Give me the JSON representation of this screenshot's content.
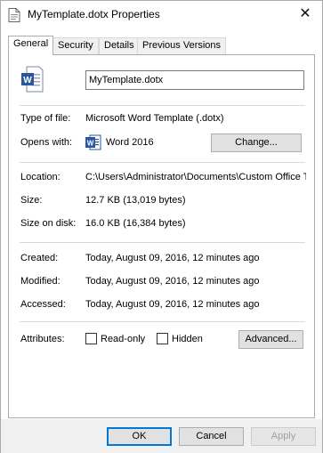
{
  "window": {
    "title": "MyTemplate.dotx Properties",
    "close_glyph": "✕"
  },
  "tabs": [
    {
      "label": "General",
      "active": true
    },
    {
      "label": "Security",
      "active": false
    },
    {
      "label": "Details",
      "active": false
    },
    {
      "label": "Previous Versions",
      "active": false
    }
  ],
  "general": {
    "file_icon": "word-document-icon",
    "filename_value": "MyTemplate.dotx",
    "type_label": "Type of file:",
    "type_value": "Microsoft Word Template (.dotx)",
    "opens_label": "Opens with:",
    "opens_app_icon": "word-app-icon",
    "opens_value": "Word 2016",
    "change_button": "Change...",
    "location_label": "Location:",
    "location_value": "C:\\Users\\Administrator\\Documents\\Custom Office T",
    "size_label": "Size:",
    "size_value": "12.7 KB (13,019 bytes)",
    "size_on_disk_label": "Size on disk:",
    "size_on_disk_value": "16.0 KB (16,384 bytes)",
    "created_label": "Created:",
    "created_value": "Today, August 09, 2016, 12 minutes ago",
    "modified_label": "Modified:",
    "modified_value": "Today, August 09, 2016, 12 minutes ago",
    "accessed_label": "Accessed:",
    "accessed_value": "Today, August 09, 2016, 12 minutes ago",
    "attributes_label": "Attributes:",
    "readonly_label": "Read-only",
    "readonly_checked": false,
    "hidden_label": "Hidden",
    "hidden_checked": false,
    "advanced_button": "Advanced..."
  },
  "footer": {
    "ok_label": "OK",
    "cancel_label": "Cancel",
    "apply_label": "Apply"
  },
  "colors": {
    "word_blue": "#2b579a",
    "focus_blue": "#0078d7"
  }
}
